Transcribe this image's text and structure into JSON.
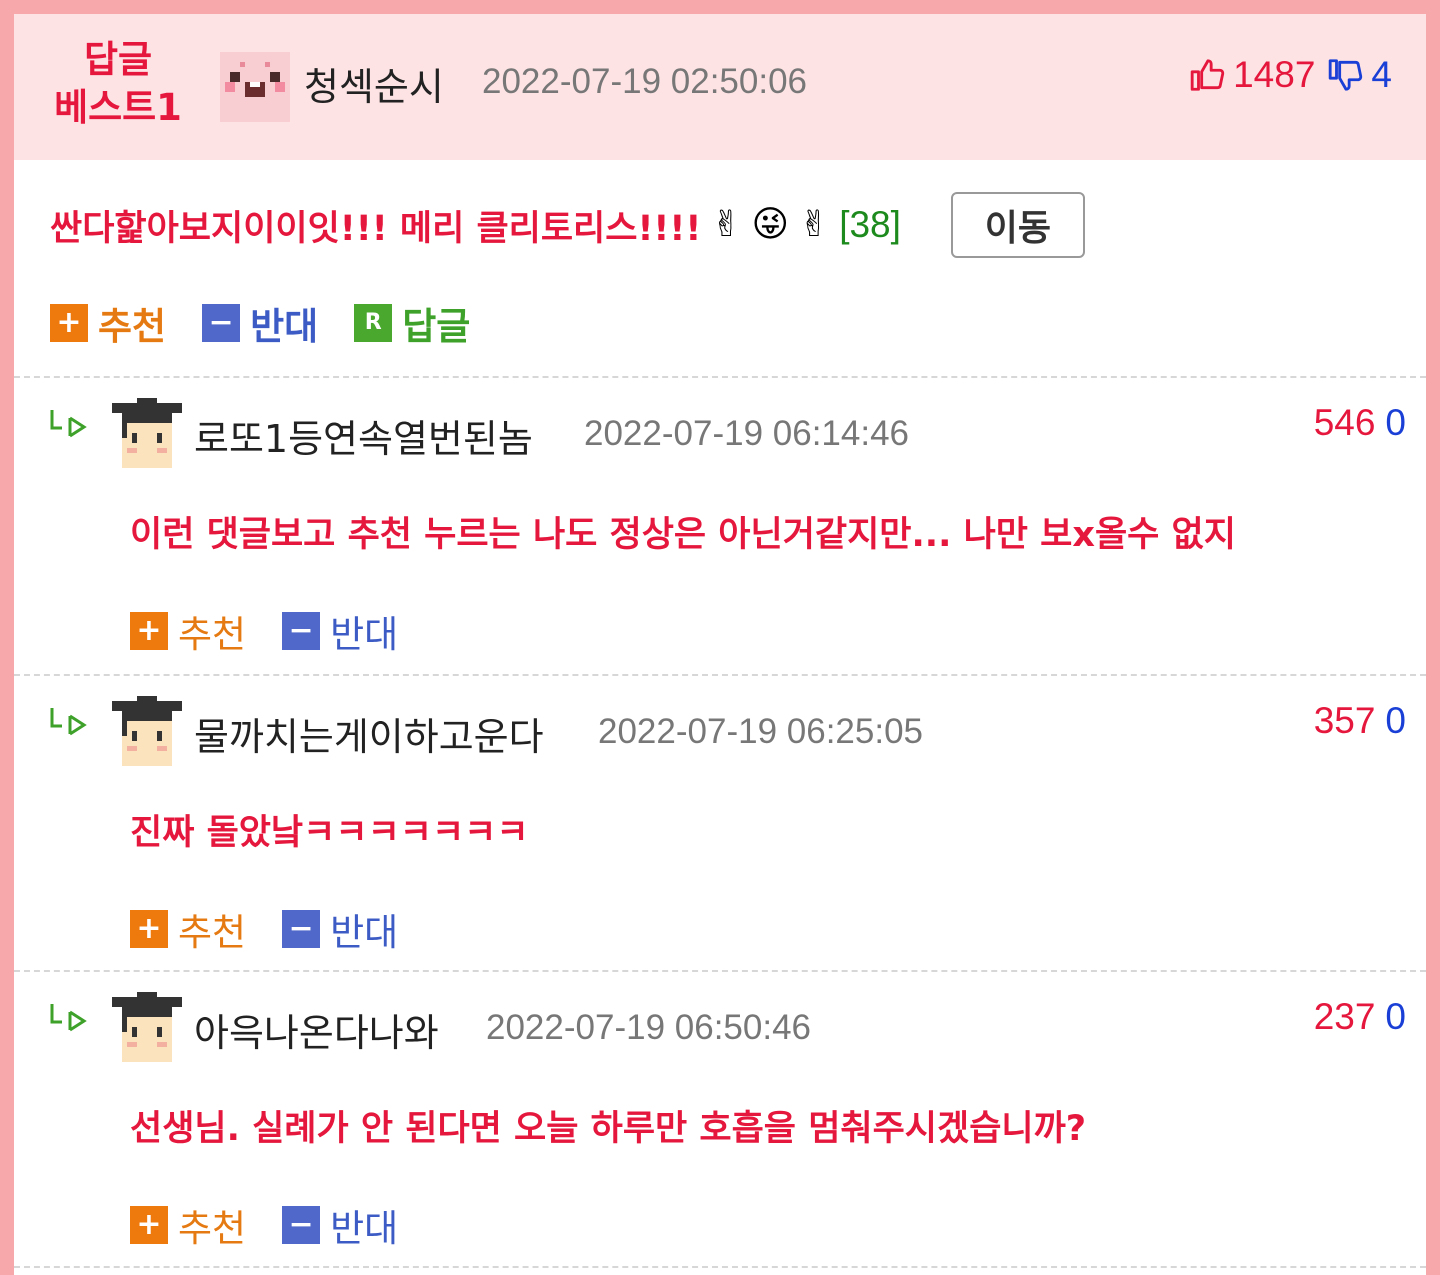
{
  "best": {
    "badge_line1": "답글",
    "badge_line2": "베스트1",
    "author": "청섹순시",
    "date": "2022-07-19 02:50:06",
    "up_count": "1487",
    "down_count": "4",
    "comment": "싼다핥아보지이이잇!!! 메리 클리토리스!!!!",
    "emojis": [
      "✌",
      "😜",
      "✌"
    ],
    "reply_count": "[38]",
    "move_label": "이동",
    "actions": {
      "recommend": "추천",
      "oppose": "반대",
      "reply": "답글",
      "recommend_icon": "+",
      "oppose_icon": "−",
      "reply_icon": "R"
    }
  },
  "replies": [
    {
      "author": "로또1등연속열번된놈",
      "date": "2022-07-19 06:14:46",
      "up": "546",
      "down": "0",
      "text": "이런 댓글보고 추천 누르는 나도 정상은 아닌거같지만... 나만 보x올수 없지",
      "recommend": "추천",
      "oppose": "반대"
    },
    {
      "author": "물까치는게이하고운다",
      "date": "2022-07-19 06:25:05",
      "up": "357",
      "down": "0",
      "text": "진짜 돌았낰ㅋㅋㅋㅋㅋㅋㅋ",
      "recommend": "추천",
      "oppose": "반대"
    },
    {
      "author": "아윽나온다나와",
      "date": "2022-07-19 06:50:46",
      "up": "237",
      "down": "0",
      "text": "선생님. 실례가 안 된다면 오늘 하루만 호흡을 멈춰주시겠습니까?",
      "recommend": "추천",
      "oppose": "반대"
    }
  ],
  "colors": {
    "accent_red": "#e5173c",
    "header_bg": "#fde3e4",
    "frame": "#f7a8ab",
    "down_blue": "#1a3fd6",
    "reply_green": "#1d8a1d",
    "recommend_orange": "#ee7a0e",
    "oppose_blue": "#4f68c9"
  }
}
